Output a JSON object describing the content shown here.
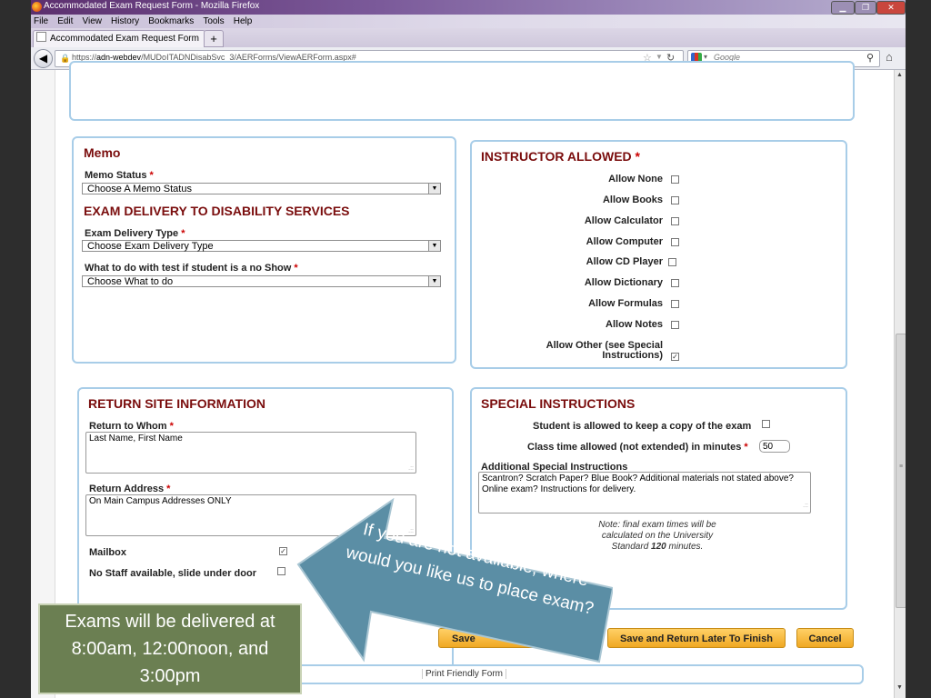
{
  "browser": {
    "window_title": "Accommodated Exam Request Form - Mozilla Firefox",
    "menu": [
      "File",
      "Edit",
      "View",
      "History",
      "Bookmarks",
      "Tools",
      "Help"
    ],
    "tab_title": "Accommodated Exam Request Form",
    "new_tab": "+",
    "url_prefix": "https://",
    "url_host": "adn-webdev",
    "url_path": "/MUDoITADNDisabSvc_3/AERForms/ViewAERForm.aspx#",
    "search_placeholder": "Google"
  },
  "memo": {
    "title": "Memo",
    "status_label": "Memo Status",
    "status_value": "Choose A Memo Status"
  },
  "delivery": {
    "title": "EXAM DELIVERY TO DISABILITY SERVICES",
    "type_label": "Exam Delivery Type",
    "type_value": "Choose Exam Delivery Type",
    "noshow_label": "What to do with test if student is a no Show",
    "noshow_value": "Choose What to do"
  },
  "instructor": {
    "title": "INSTRUCTOR ALLOWED",
    "items": [
      {
        "label": "Allow None",
        "checked": false
      },
      {
        "label": "Allow Books",
        "checked": false
      },
      {
        "label": "Allow Calculator",
        "checked": false
      },
      {
        "label": "Allow Computer",
        "checked": false
      },
      {
        "label": "Allow CD Player",
        "checked": false
      },
      {
        "label": "Allow Dictionary",
        "checked": false
      },
      {
        "label": "Allow Formulas",
        "checked": false
      },
      {
        "label": "Allow Notes",
        "checked": false
      }
    ],
    "other_line1": "Allow Other (see Special",
    "other_line2": "Instructions)",
    "other_checked": true
  },
  "return_site": {
    "title": "RETURN SITE INFORMATION",
    "whom_label": "Return to Whom",
    "whom_value": "Last Name, First Name",
    "address_label": "Return Address",
    "address_value": "On Main Campus Addresses ONLY",
    "mailbox_label": "Mailbox",
    "mailbox_checked": true,
    "nostaff_label": "No Staff available, slide under door",
    "nostaff_checked": false
  },
  "special": {
    "title": "SPECIAL INSTRUCTIONS",
    "keep_copy_label": "Student is allowed to keep a copy of the exam",
    "keep_copy_checked": false,
    "class_time_label": "Class time allowed (not extended) in minutes",
    "class_time_value": "50",
    "additional_label": "Additional Special Instructions",
    "additional_value": "Scantron?  Scratch Paper?  Blue Book?  Additional materials not stated above?  Online exam?  Instructions for delivery.",
    "note_line1": "Note: final exam times will be",
    "note_line2": "calculated on the University",
    "note_line3_pre": "Standard ",
    "note_line3_bold": "120",
    "note_line3_post": " minutes."
  },
  "buttons": {
    "save_partial": "Save",
    "save_later": "Save and Return Later To Finish",
    "cancel": "Cancel",
    "print": "Print Friendly Form"
  },
  "overlay": {
    "callout": "Exams will be delivered at 8:00am, 12:00noon, and 3:00pm",
    "arrow_text": "If you are not available, where would you like us to place exam?"
  },
  "colors": {
    "panel_border": "#a8cde8",
    "title_red": "#7a0d0d",
    "button_orange": "#f0a823",
    "callout_green": "#6b7f52",
    "arrow_blue": "#5b8ea5"
  }
}
